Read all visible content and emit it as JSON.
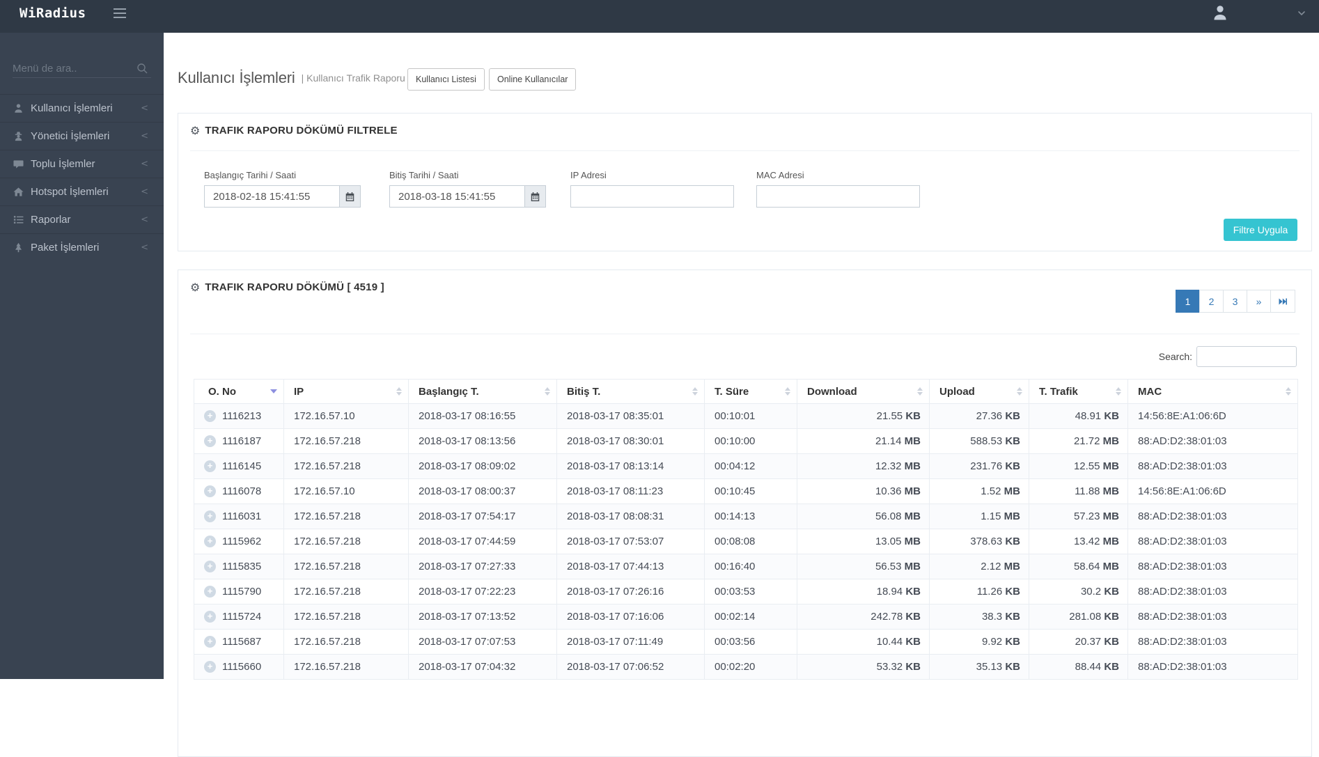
{
  "topbar": {
    "logo": "WiRadius"
  },
  "sidebar": {
    "search_placeholder": "Menü de ara..",
    "items": [
      {
        "label": "Kullanıcı İşlemleri",
        "icon": "user-icon"
      },
      {
        "label": "Yönetici İşlemleri",
        "icon": "user-secret-icon"
      },
      {
        "label": "Toplu İşlemler",
        "icon": "comment-icon"
      },
      {
        "label": "Hotspot İşlemleri",
        "icon": "home-icon"
      },
      {
        "label": "Raporlar",
        "icon": "list-icon"
      },
      {
        "label": "Paket İşlemleri",
        "icon": "tree-icon"
      }
    ]
  },
  "page": {
    "title": "Kullanıcı İşlemleri",
    "subtitle": "| Kullanıcı Trafik Raporu",
    "button1": "Kullanıcı Listesi",
    "button2": "Online Kullanıcılar"
  },
  "filter_panel": {
    "title": "TRAFIK RAPORU DÖKÜMÜ FILTRELE",
    "fields": [
      {
        "label": "Başlangıç Tarihi / Saati",
        "value": "2018-02-18 15:41:55"
      },
      {
        "label": "Bitiş Tarihi / Saati",
        "value": "2018-03-18 15:41:55"
      },
      {
        "label": "IP Adresi",
        "value": ""
      },
      {
        "label": "MAC Adresi",
        "value": ""
      }
    ],
    "submit_label": "Filtre Uygula",
    "accent_color": "#35c4d1"
  },
  "table_panel": {
    "title": "TRAFIK RAPORU DÖKÜMÜ [ 4519 ]",
    "pagination": [
      "1",
      "2",
      "3",
      "»"
    ],
    "active_page": "1",
    "search_label": "Search:",
    "search_value": "",
    "columns": [
      "O. No",
      "IP",
      "Başlangıç T.",
      "Bitiş T.",
      "T. Süre",
      "Download",
      "Upload",
      "T. Trafik",
      "MAC"
    ],
    "rows": [
      {
        "no": "1116213",
        "ip": "172.16.57.10",
        "start": "2018-03-17 08:16:55",
        "end": "2018-03-17 08:35:01",
        "dur": "00:10:01",
        "down": "21.55",
        "down_u": "KB",
        "up": "27.36",
        "up_u": "KB",
        "traf": "48.91",
        "traf_u": "KB",
        "mac": "14:56:8E:A1:06:6D"
      },
      {
        "no": "1116187",
        "ip": "172.16.57.218",
        "start": "2018-03-17 08:13:56",
        "end": "2018-03-17 08:30:01",
        "dur": "00:10:00",
        "down": "21.14",
        "down_u": "MB",
        "up": "588.53",
        "up_u": "KB",
        "traf": "21.72",
        "traf_u": "MB",
        "mac": "88:AD:D2:38:01:03"
      },
      {
        "no": "1116145",
        "ip": "172.16.57.218",
        "start": "2018-03-17 08:09:02",
        "end": "2018-03-17 08:13:14",
        "dur": "00:04:12",
        "down": "12.32",
        "down_u": "MB",
        "up": "231.76",
        "up_u": "KB",
        "traf": "12.55",
        "traf_u": "MB",
        "mac": "88:AD:D2:38:01:03"
      },
      {
        "no": "1116078",
        "ip": "172.16.57.10",
        "start": "2018-03-17 08:00:37",
        "end": "2018-03-17 08:11:23",
        "dur": "00:10:45",
        "down": "10.36",
        "down_u": "MB",
        "up": "1.52",
        "up_u": "MB",
        "traf": "11.88",
        "traf_u": "MB",
        "mac": "14:56:8E:A1:06:6D"
      },
      {
        "no": "1116031",
        "ip": "172.16.57.218",
        "start": "2018-03-17 07:54:17",
        "end": "2018-03-17 08:08:31",
        "dur": "00:14:13",
        "down": "56.08",
        "down_u": "MB",
        "up": "1.15",
        "up_u": "MB",
        "traf": "57.23",
        "traf_u": "MB",
        "mac": "88:AD:D2:38:01:03"
      },
      {
        "no": "1115962",
        "ip": "172.16.57.218",
        "start": "2018-03-17 07:44:59",
        "end": "2018-03-17 07:53:07",
        "dur": "00:08:08",
        "down": "13.05",
        "down_u": "MB",
        "up": "378.63",
        "up_u": "KB",
        "traf": "13.42",
        "traf_u": "MB",
        "mac": "88:AD:D2:38:01:03"
      },
      {
        "no": "1115835",
        "ip": "172.16.57.218",
        "start": "2018-03-17 07:27:33",
        "end": "2018-03-17 07:44:13",
        "dur": "00:16:40",
        "down": "56.53",
        "down_u": "MB",
        "up": "2.12",
        "up_u": "MB",
        "traf": "58.64",
        "traf_u": "MB",
        "mac": "88:AD:D2:38:01:03"
      },
      {
        "no": "1115790",
        "ip": "172.16.57.218",
        "start": "2018-03-17 07:22:23",
        "end": "2018-03-17 07:26:16",
        "dur": "00:03:53",
        "down": "18.94",
        "down_u": "KB",
        "up": "11.26",
        "up_u": "KB",
        "traf": "30.2",
        "traf_u": "KB",
        "mac": "88:AD:D2:38:01:03"
      },
      {
        "no": "1115724",
        "ip": "172.16.57.218",
        "start": "2018-03-17 07:13:52",
        "end": "2018-03-17 07:16:06",
        "dur": "00:02:14",
        "down": "242.78",
        "down_u": "KB",
        "up": "38.3",
        "up_u": "KB",
        "traf": "281.08",
        "traf_u": "KB",
        "mac": "88:AD:D2:38:01:03"
      },
      {
        "no": "1115687",
        "ip": "172.16.57.218",
        "start": "2018-03-17 07:07:53",
        "end": "2018-03-17 07:11:49",
        "dur": "00:03:56",
        "down": "10.44",
        "down_u": "KB",
        "up": "9.92",
        "up_u": "KB",
        "traf": "20.37",
        "traf_u": "KB",
        "mac": "88:AD:D2:38:01:03"
      },
      {
        "no": "1115660",
        "ip": "172.16.57.218",
        "start": "2018-03-17 07:04:32",
        "end": "2018-03-17 07:06:52",
        "dur": "00:02:20",
        "down": "53.32",
        "down_u": "KB",
        "up": "35.13",
        "up_u": "KB",
        "traf": "88.44",
        "traf_u": "KB",
        "mac": "88:AD:D2:38:01:03"
      }
    ]
  }
}
